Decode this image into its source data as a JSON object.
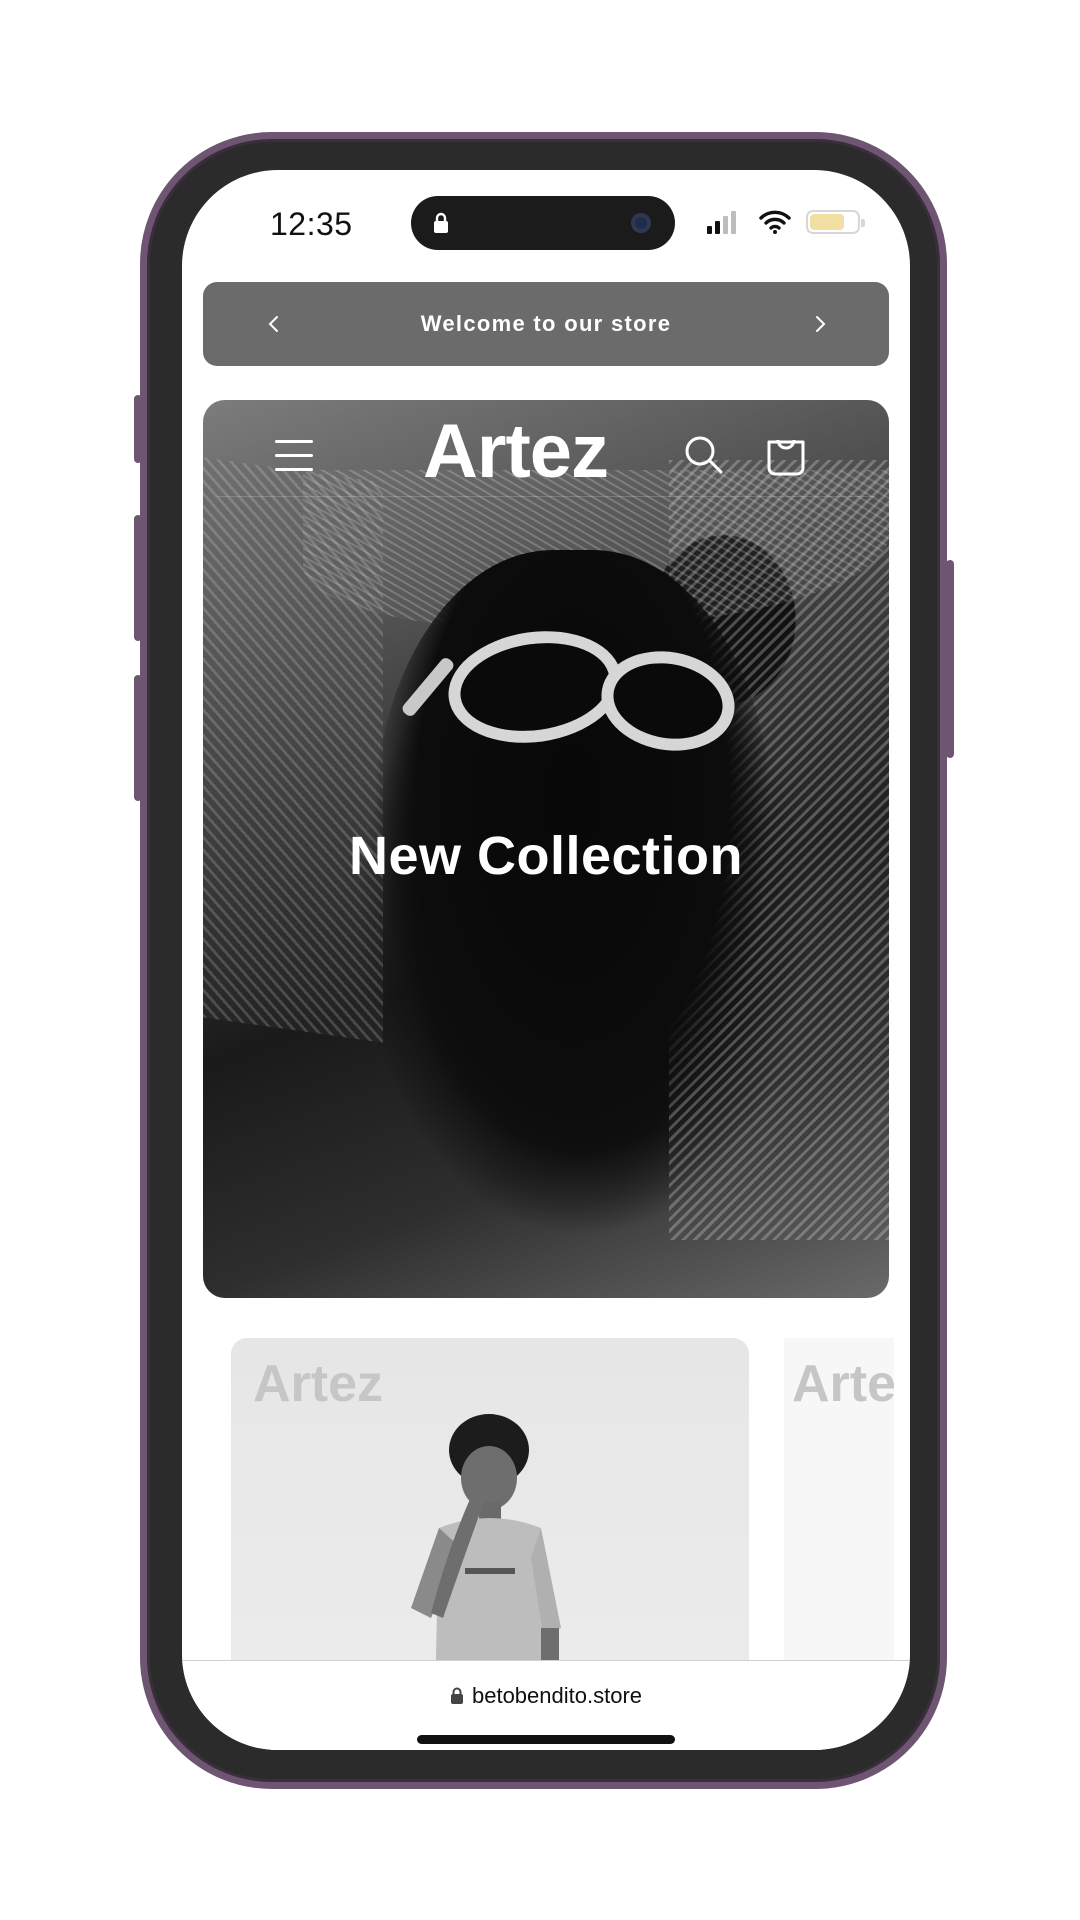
{
  "status_bar": {
    "time": "12:35"
  },
  "announcement": {
    "text": "Welcome to our store"
  },
  "header": {
    "logo": "Artez"
  },
  "hero": {
    "title": "New Collection"
  },
  "products": [
    {
      "brand": "Artez"
    },
    {
      "brand": "Artez"
    }
  ],
  "browser": {
    "url": "betobendito.store"
  }
}
